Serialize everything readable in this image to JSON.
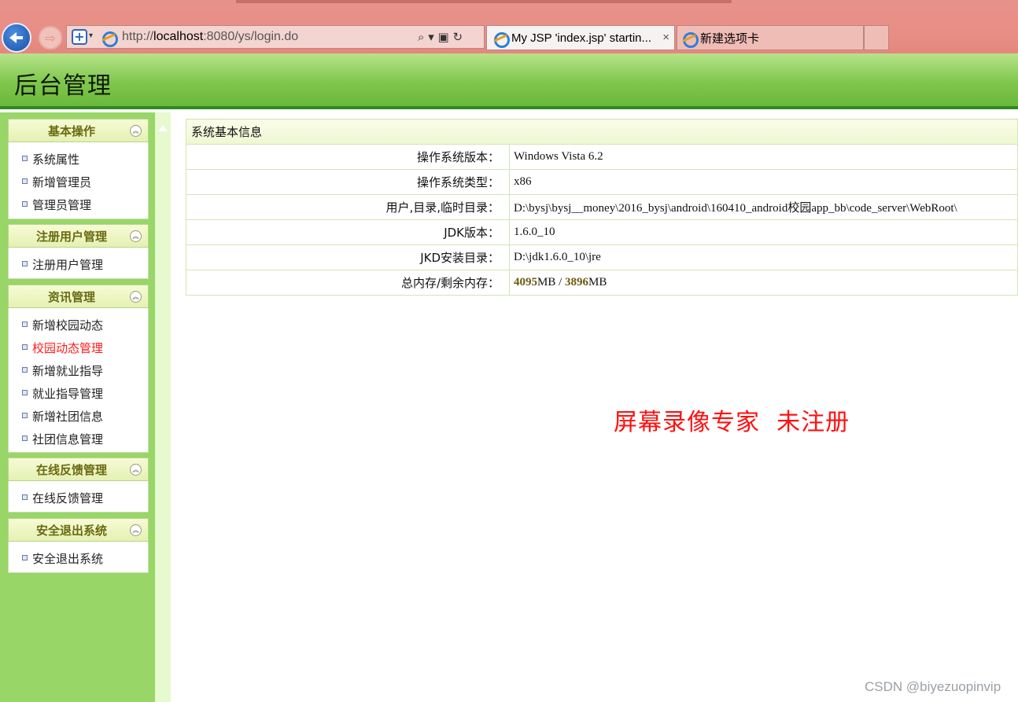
{
  "browser": {
    "url_prefix": "http://",
    "url_host": "localhost",
    "url_rest": ":8080/ys/login.do",
    "tabs": [
      {
        "title": "My JSP 'index.jsp' startin...",
        "close": "×"
      },
      {
        "title": "新建选项卡"
      }
    ]
  },
  "header": {
    "title": "后台管理"
  },
  "sidebar": {
    "groups": [
      {
        "title": "基本操作",
        "items": [
          "系统属性",
          "新增管理员",
          "管理员管理"
        ]
      },
      {
        "title": "注册用户管理",
        "items": [
          "注册用户管理"
        ]
      },
      {
        "title": "资讯管理",
        "items": [
          "新增校园动态",
          "校园动态管理",
          "新增就业指导",
          "就业指导管理",
          "新增社团信息",
          "社团信息管理"
        ]
      },
      {
        "title": "在线反馈管理",
        "items": [
          "在线反馈管理"
        ]
      },
      {
        "title": "安全退出系统",
        "items": [
          "安全退出系统"
        ]
      }
    ],
    "active_item": "校园动态管理"
  },
  "info": {
    "caption": "系统基本信息",
    "rows": [
      {
        "key": "操作系统版本：",
        "value": "Windows Vista  6.2"
      },
      {
        "key": "操作系统类型：",
        "value": "x86"
      },
      {
        "key": "用户,目录,临时目录：",
        "value": "D:\\bysj\\bysj__money\\2016_bysj\\android\\160410_android校园app_bb\\code_server\\WebRoot\\"
      },
      {
        "key": "JDK版本：",
        "value": "1.6.0_10"
      },
      {
        "key": "JKD安装目录：",
        "value": "D:\\jdk1.6.0_10\\jre"
      }
    ],
    "memory": {
      "key": "总内存/剩余内存：",
      "total": "4095",
      "free": "3896",
      "unit": "MB",
      "sep": " / "
    }
  },
  "watermark": "屏幕录像专家  未注册",
  "credit": "CSDN @biyezuopinvip",
  "colors": {
    "header_green": "#7fc74c",
    "sidebar_green": "#97d667",
    "active_red": "#ff1a1a",
    "watermark_red": "#ff1010"
  }
}
